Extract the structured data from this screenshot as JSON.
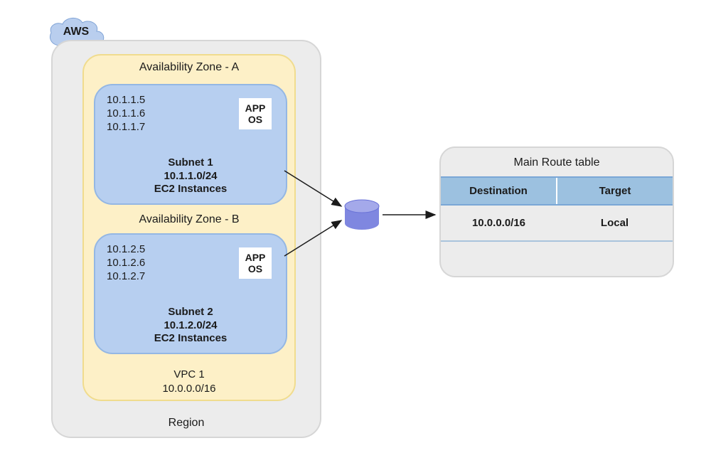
{
  "cloud": {
    "label": "AWS"
  },
  "region": {
    "label": "Region"
  },
  "vpc": {
    "title": "Availability Zone - A",
    "azB": "Availability Zone - B",
    "footer_name": "VPC 1",
    "footer_cidr": "10.0.0.0/16"
  },
  "subnets": [
    {
      "ips": [
        "10.1.1.5",
        "10.1.1.6",
        "10.1.1.7"
      ],
      "app": "APP",
      "os": "OS",
      "name": "Subnet 1",
      "cidr": "10.1.1.0/24",
      "instances": "EC2 Instances"
    },
    {
      "ips": [
        "10.1.2.5",
        "10.1.2.6",
        "10.1.2.7"
      ],
      "app": "APP",
      "os": "OS",
      "name": "Subnet 2",
      "cidr": "10.1.2.0/24",
      "instances": "EC2 Instances"
    }
  ],
  "routeTable": {
    "title": "Main Route table",
    "headers": {
      "destination": "Destination",
      "target": "Target"
    },
    "rows": [
      {
        "destination": "10.0.0.0/16",
        "target": "Local"
      }
    ]
  },
  "colors": {
    "cloud": "#b9ceee",
    "subnet": "#b7cff0",
    "vpc": "#fdf0c7",
    "region": "#ececec",
    "routerTop": "#a4a9ea",
    "routerSide": "#7f87e0",
    "headerBlue": "#9cc1e0"
  }
}
